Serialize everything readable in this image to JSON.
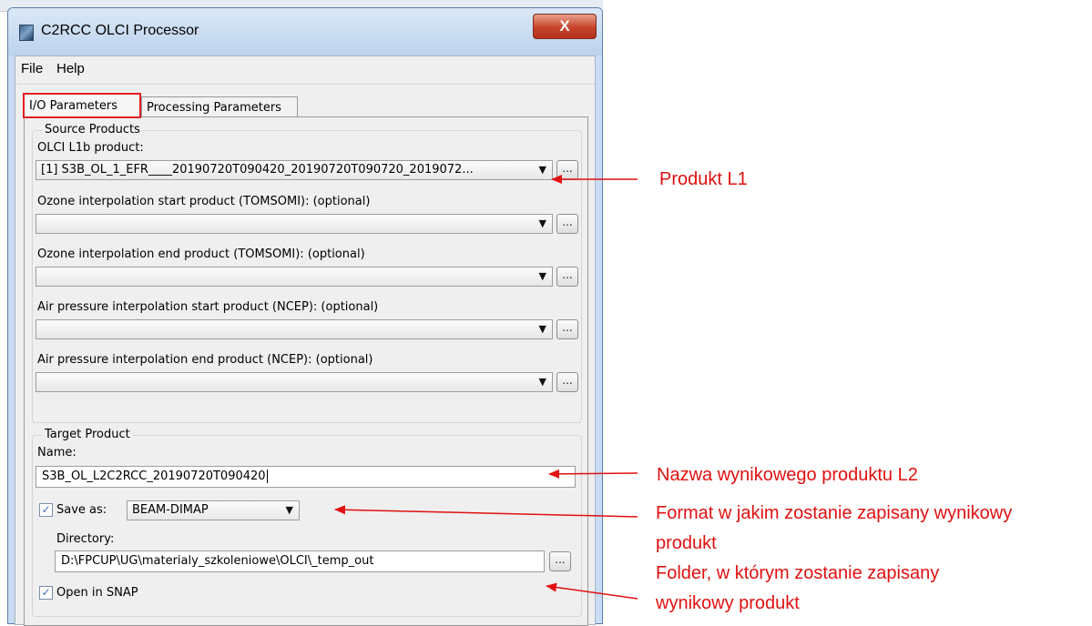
{
  "window": {
    "title": "C2RCC OLCI Processor",
    "close_glyph": "X"
  },
  "menu": [
    "File",
    "Help"
  ],
  "tabs": [
    {
      "label": "I/O Parameters",
      "active": true
    },
    {
      "label": "Processing Parameters",
      "active": false
    }
  ],
  "source_products": {
    "group_title": "Source Products",
    "browse_glyph": "...",
    "fields": [
      {
        "label": "OLCI L1b product:",
        "value": "[1] S3B_OL_1_EFR____20190720T090420_20190720T090720_2019072..."
      },
      {
        "label": "Ozone interpolation start product (TOMSOMI): (optional)",
        "value": ""
      },
      {
        "label": "Ozone interpolation end product (TOMSOMI): (optional)",
        "value": ""
      },
      {
        "label": "Air pressure interpolation start product (NCEP): (optional)",
        "value": ""
      },
      {
        "label": "Air pressure interpolation end product (NCEP): (optional)",
        "value": ""
      }
    ]
  },
  "target_product": {
    "group_title": "Target Product",
    "name_label": "Name:",
    "name_value": "S3B_OL_L2C2RCC_20190720T090420",
    "save_as_checked": true,
    "save_as_label": "Save as:",
    "format_value": "BEAM-DIMAP",
    "directory_label": "Directory:",
    "directory_value": "D:\\FPCUP\\UG\\materialy_szkoleniowe\\OLCI\\_temp_out",
    "open_in_snap_checked": true,
    "open_in_snap_label": "Open in SNAP",
    "check_glyph": "✓"
  },
  "annotations": {
    "l1": "Produkt L1",
    "name": "Nazwa wynikowego produktu L2",
    "format_line1": "Format w jakim zostanie zapisany wynikowy",
    "format_line2": "produkt",
    "folder_line1": "Folder, w którym zostanie zapisany",
    "folder_line2": "wynikowy produkt"
  },
  "colors": {
    "annotation_red": "#e01010",
    "tab_highlight": "#e02020"
  }
}
